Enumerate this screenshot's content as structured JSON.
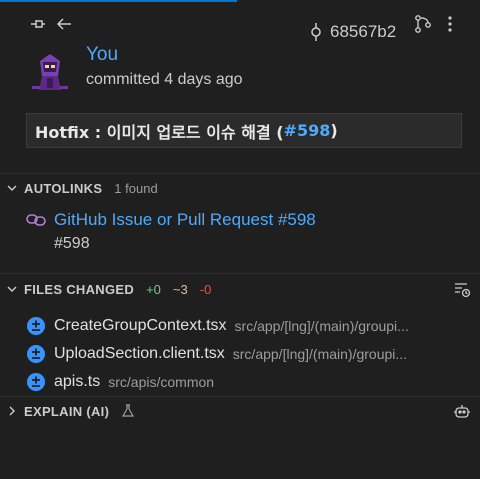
{
  "header": {
    "sha": "68567b2"
  },
  "commit": {
    "author": "You",
    "date_text": "committed 4 days ago",
    "message_prefix": "Hotfix : 이미지 업로드 이슈 해결 (",
    "message_link": "#598",
    "message_suffix": ")"
  },
  "autolinks": {
    "title": "AUTOLINKS",
    "count": "1 found",
    "items": [
      {
        "label": "GitHub Issue or Pull Request #598",
        "sub": "#598"
      }
    ]
  },
  "files_changed": {
    "title": "FILES CHANGED",
    "added": "+0",
    "modified": "~3",
    "deleted": "-0",
    "files": [
      {
        "name": "CreateGroupContext.tsx",
        "path": "src/app/[lng]/(main)/groupi..."
      },
      {
        "name": "UploadSection.client.tsx",
        "path": "src/app/[lng]/(main)/groupi..."
      },
      {
        "name": "apis.ts",
        "path": "src/apis/common"
      }
    ]
  },
  "explain": {
    "title": "EXPLAIN (AI)"
  },
  "colors": {
    "accent": "#0078d4",
    "link": "#4daafc",
    "added": "#73c991",
    "modified": "#e2c08d",
    "deleted": "#f14c4c",
    "file_badge": "#3794ff",
    "autolink_icon": "#b180d7"
  }
}
